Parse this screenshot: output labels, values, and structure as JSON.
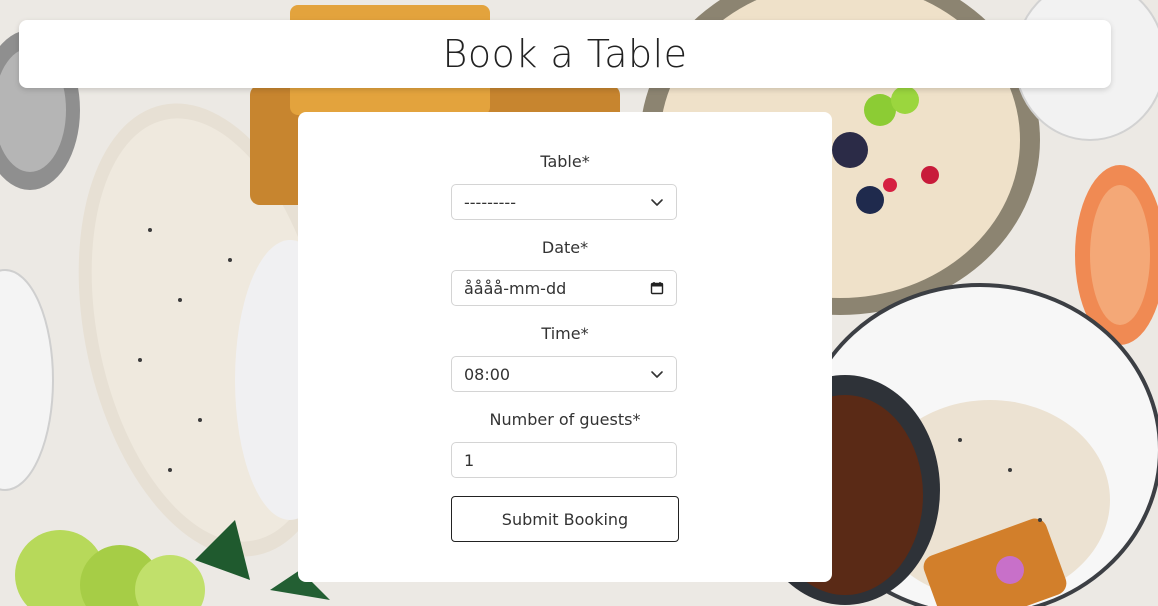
{
  "page": {
    "title": "Book a Table"
  },
  "form": {
    "table": {
      "label": "Table*",
      "value": "---------"
    },
    "date": {
      "label": "Date*",
      "value": "åååå-mm-dd"
    },
    "time": {
      "label": "Time*",
      "value": "08:00"
    },
    "guests": {
      "label": "Number of guests*",
      "value": "1"
    },
    "submit_label": "Submit Booking"
  },
  "icons": {
    "table_dropdown": "chevron-down-icon",
    "date_picker": "calendar-icon",
    "time_dropdown": "chevron-down-icon"
  },
  "colors": {
    "card_bg": "#ffffff",
    "text": "#333333",
    "border": "#d4d4d4",
    "button_border": "#222222"
  }
}
